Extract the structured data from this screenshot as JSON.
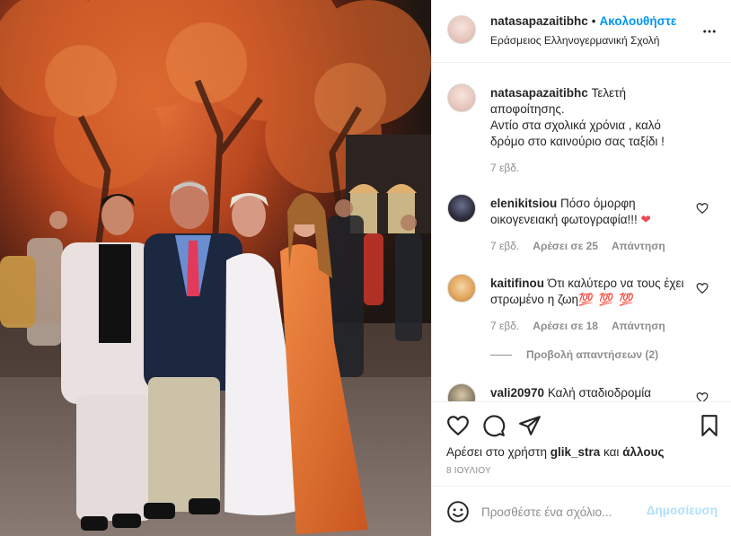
{
  "post": {
    "username": "natasapazaitibhc",
    "separator": "•",
    "follow_label": "Ακολουθήστε",
    "location": "Εράσμειος Ελληνογερμανική Σχολή",
    "more_icon": "more-horizontal-icon",
    "caption": {
      "username": "natasapazaitibhc",
      "text": "Τελετή αποφοίτησης.\nΑντίο στα σχολικά χρόνια , καλό δρόμο στο καινούριο σας ταξίδι !",
      "time": "7 εβδ."
    }
  },
  "comments": [
    {
      "username": "elenikitsiou",
      "text": "Πόσο όμορφη οικογενειακή φωτογραφία!!!",
      "emoji": "❤",
      "time": "7 εβδ.",
      "likes": "Αρέσει σε 25",
      "reply_label": "Απάντηση"
    },
    {
      "username": "kaitifinou",
      "text": "Ότι καλύτερο να τους έχει στρωμένο η ζωη",
      "emoji": "💯 💯 💯",
      "time": "7 εβδ.",
      "likes": "Αρέσει σε 18",
      "reply_label": "Απάντηση",
      "view_replies": "Προβολή απαντήσεων (2)"
    },
    {
      "username": "vali20970",
      "text": "Καλή σταδιοδρομία"
    }
  ],
  "actions": {
    "like_icon": "heart-icon",
    "comment_icon": "comment-icon",
    "share_icon": "send-icon",
    "save_icon": "bookmark-icon"
  },
  "likes_line": {
    "prefix": "Αρέσει στο χρήστη",
    "user": "glik_stra",
    "middle": "και",
    "others": "άλλους"
  },
  "date": "8 ΙΟΥΛΙΟΥ",
  "composer": {
    "placeholder": "Προσθέστε ένα σχόλιο...",
    "post_label": "Δημοσίευση",
    "emoji_icon": "smiley-icon"
  },
  "colors": {
    "accent": "#0095f6",
    "heart": "#ed4956",
    "post_disabled": "#b2dffc"
  }
}
